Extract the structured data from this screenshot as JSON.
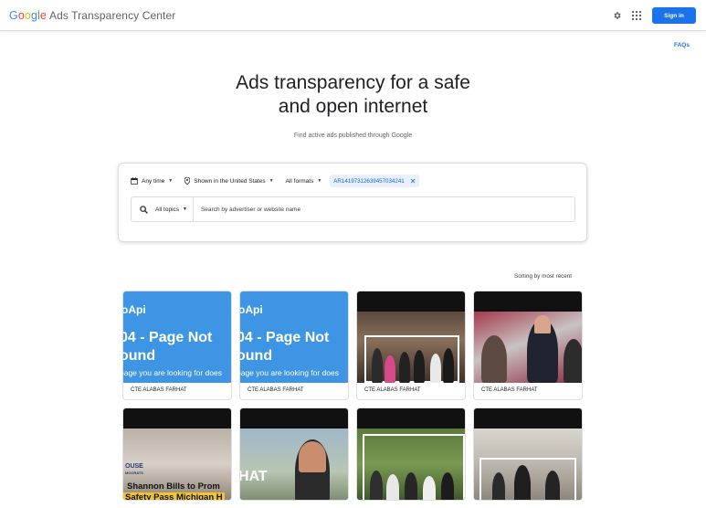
{
  "header": {
    "logo_word": [
      "G",
      "o",
      "o",
      "g",
      "l",
      "e"
    ],
    "app_name": "Ads Transparency Center",
    "signin_label": "Sign in"
  },
  "faqs_label": "FAQs",
  "hero": {
    "title_line1": "Ads transparency for a safe",
    "title_line2": "and open internet",
    "subtitle": "Find active ads published through Google"
  },
  "filters": {
    "time": "Any time",
    "region": "Shown in the United States",
    "format": "All formats",
    "creative_chip": "AR14197312639457034241"
  },
  "search": {
    "topics": "All topics",
    "placeholder": "Search by advertiser or website name"
  },
  "sorting_label": "Sorting by most recent",
  "cards": [
    {
      "advertiser": "CTE ALABAS FARHAT",
      "type": "error",
      "api": "oApi",
      "err_line1": "04 - Page Not",
      "err_line2": "ound",
      "err_line3": "page you are looking for does"
    },
    {
      "advertiser": "CTE ALABAS FARHAT",
      "type": "error",
      "api": "oApi",
      "err_line1": "04 - Page Not",
      "err_line2": "ound",
      "err_line3": "page you are looking for does"
    },
    {
      "advertiser": "CTE ALABAS FARHAT",
      "type": "photo"
    },
    {
      "advertiser": "CTE ALABAS FARHAT",
      "type": "photo"
    }
  ],
  "cards_row2": [
    {
      "overlay_line1": "OUSE",
      "overlay_line2": "MOCRATS",
      "overlay_line3": "Shannon Bills to Prom",
      "overlay_line4": "Safety Pass Michigan H"
    },
    {
      "overlay_line1": "HAT"
    },
    {},
    {}
  ],
  "colors": {
    "accent": "#1a73e8",
    "card_blue": "#3d95e3",
    "chip_bg": "#e8f0fe"
  }
}
